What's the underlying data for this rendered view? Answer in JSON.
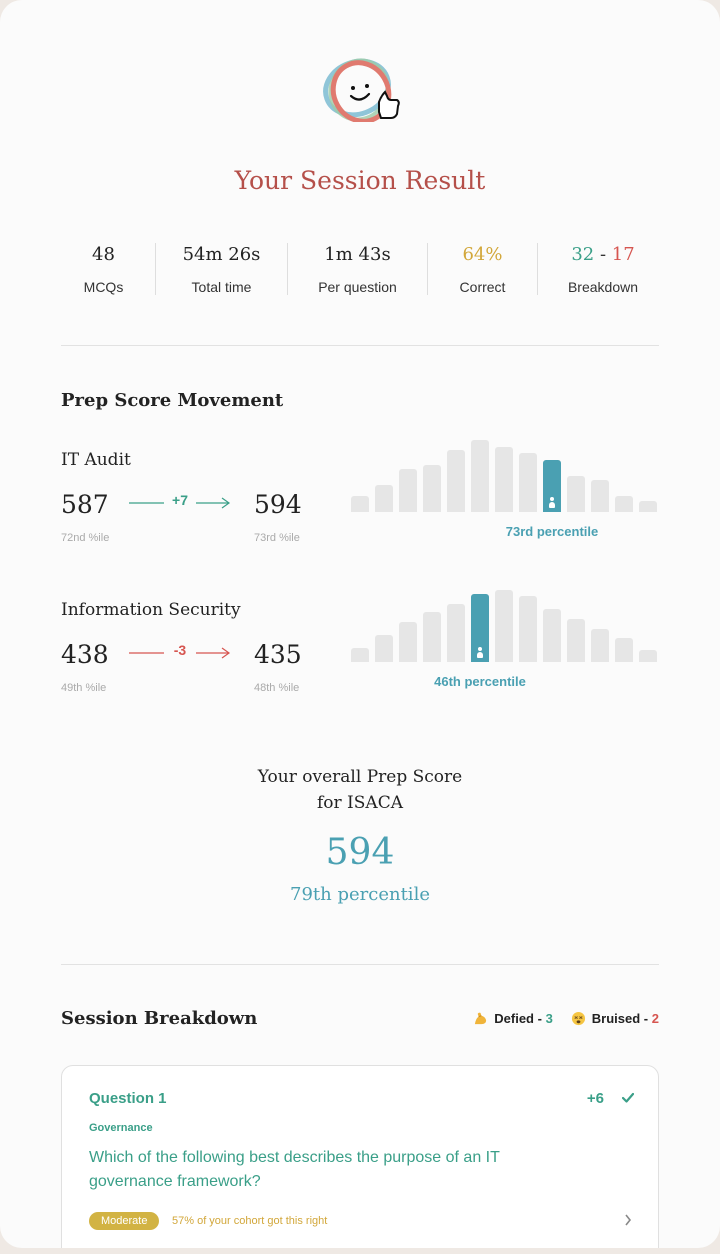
{
  "header": {
    "title": "Your Session Result"
  },
  "stats": [
    {
      "value": "48",
      "label": "MCQs"
    },
    {
      "value": "54m 26s",
      "label": "Total time"
    },
    {
      "value": "1m 43s",
      "label": "Per question"
    },
    {
      "value": "64%",
      "label": "Correct"
    },
    {
      "value_pos": "32",
      "value_sep": " - ",
      "value_neg": "17",
      "label": "Breakdown"
    }
  ],
  "movement": {
    "heading": "Prep Score Movement",
    "topics": [
      {
        "name": "IT Audit",
        "from": "587",
        "from_pct": "72nd %ile",
        "delta": "+7",
        "to": "594",
        "to_pct": "73rd %ile",
        "percentile_label": "73rd percentile",
        "distribution": [
          0.22,
          0.38,
          0.6,
          0.65,
          0.86,
          1.0,
          0.9,
          0.82,
          0.72,
          0.5,
          0.44,
          0.22,
          0.15
        ],
        "highlight_index": 8
      },
      {
        "name": "Information Security",
        "from": "438",
        "from_pct": "49th %ile",
        "delta": "-3",
        "to": "435",
        "to_pct": "48th %ile",
        "percentile_label": "46th percentile",
        "distribution": [
          0.2,
          0.38,
          0.56,
          0.7,
          0.8,
          0.94,
          1.0,
          0.92,
          0.74,
          0.6,
          0.46,
          0.34,
          0.16
        ],
        "highlight_index": 5
      }
    ]
  },
  "overall": {
    "line1": "Your overall Prep Score",
    "line2": "for ISACA",
    "score": "594",
    "percentile": "79th percentile"
  },
  "breakdown": {
    "heading": "Session Breakdown",
    "defied_label": "Defied - ",
    "defied_count": "3",
    "bruised_label": "Bruised - ",
    "bruised_count": "2"
  },
  "question": {
    "number": "Question 1",
    "score": "+6",
    "topic": "Governance",
    "text": "Which of the following best describes the purpose of an IT governance framework?",
    "difficulty": "Moderate",
    "cohort": "57% of your cohort got this right"
  },
  "colors": {
    "accent": "#4aa0b2",
    "positive": "#3a9f88",
    "negative": "#d65550",
    "title": "#b5504a",
    "gold": "#d2a73a"
  }
}
